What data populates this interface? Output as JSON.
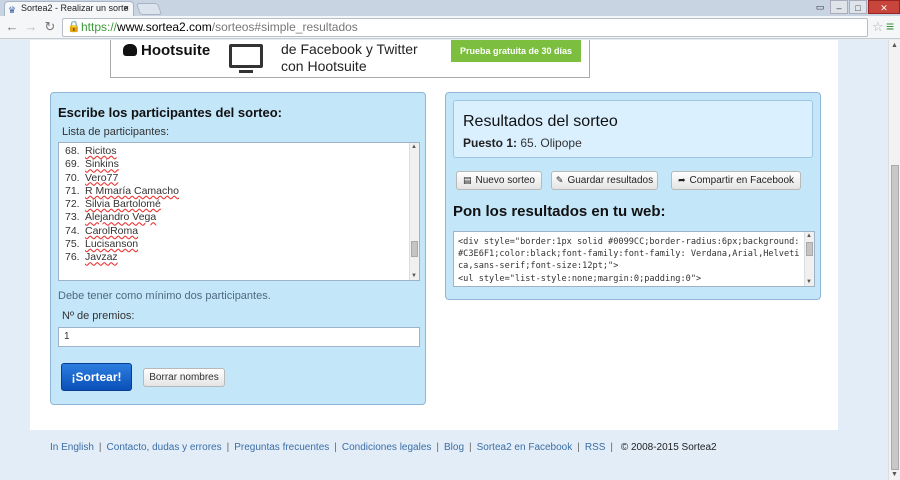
{
  "browser": {
    "tab_title": "Sortea2 - Realizar un sorte",
    "tab_close": "×",
    "url_scheme": "https://",
    "url_host": "www.sortea2.com",
    "url_path": "/sorteos#simple_resultados"
  },
  "ad": {
    "brand": "Hootsuite",
    "line1": "de Facebook y Twitter",
    "line2": "con Hootsuite",
    "cta": "Prueba gratuita de 30 días"
  },
  "participants_panel": {
    "title": "Escribe los participantes del sorteo:",
    "list_label": "Lista de participantes:",
    "items": [
      {
        "num": "68.",
        "name": "Ricitos"
      },
      {
        "num": "69.",
        "name": "Sinkins"
      },
      {
        "num": "70.",
        "name": "Vero77"
      },
      {
        "num": "71.",
        "name": "R Mmaría Camacho"
      },
      {
        "num": "72.",
        "name": "Silvia Bartolomé"
      },
      {
        "num": "73.",
        "name": "Alejandro Vega"
      },
      {
        "num": "74.",
        "name": "CarolRoma"
      },
      {
        "num": "75.",
        "name": "Lucisanson"
      },
      {
        "num": "76.",
        "name": "Javzaz"
      }
    ],
    "hint": "Debe tener como mínimo dos participantes.",
    "prizes_label": "Nº de premios:",
    "prizes_value": "1",
    "draw_button": "¡Sortear!",
    "clear_button": "Borrar nombres"
  },
  "results_panel": {
    "title": "Resultados del sorteo",
    "position_label": "Puesto 1:",
    "position_value": "65. Olipope",
    "new_draw_button": "Nuevo sorteo",
    "save_button": "Guardar resultados",
    "share_button": "Compartir en Facebook",
    "embed_title": "Pon los resultados en tu web:",
    "embed_code": "<div style=\"border:1px solid #0099CC;border-radius:6px;background:#C3E6F1;color:black;font-family:font-family: Verdana,Arial,Helvetica,sans-serif;font-size:12pt;\">\n<ul style=\"list-style:none;margin:0;padding:0\">"
  },
  "footer": {
    "links": [
      "In English",
      "Contacto, dudas y errores",
      "Preguntas frecuentes",
      "Condiciones legales",
      "Blog",
      "Sortea2 en Facebook",
      "RSS"
    ],
    "copyright": "© 2008-2015 Sortea2"
  },
  "colors": {
    "panel_bg": "#C3E6F9",
    "page_bg": "#E2EDF8",
    "primary_button": "#0A4FB8",
    "link": "#3B6EA5",
    "ad_cta": "#7CBF3E"
  }
}
